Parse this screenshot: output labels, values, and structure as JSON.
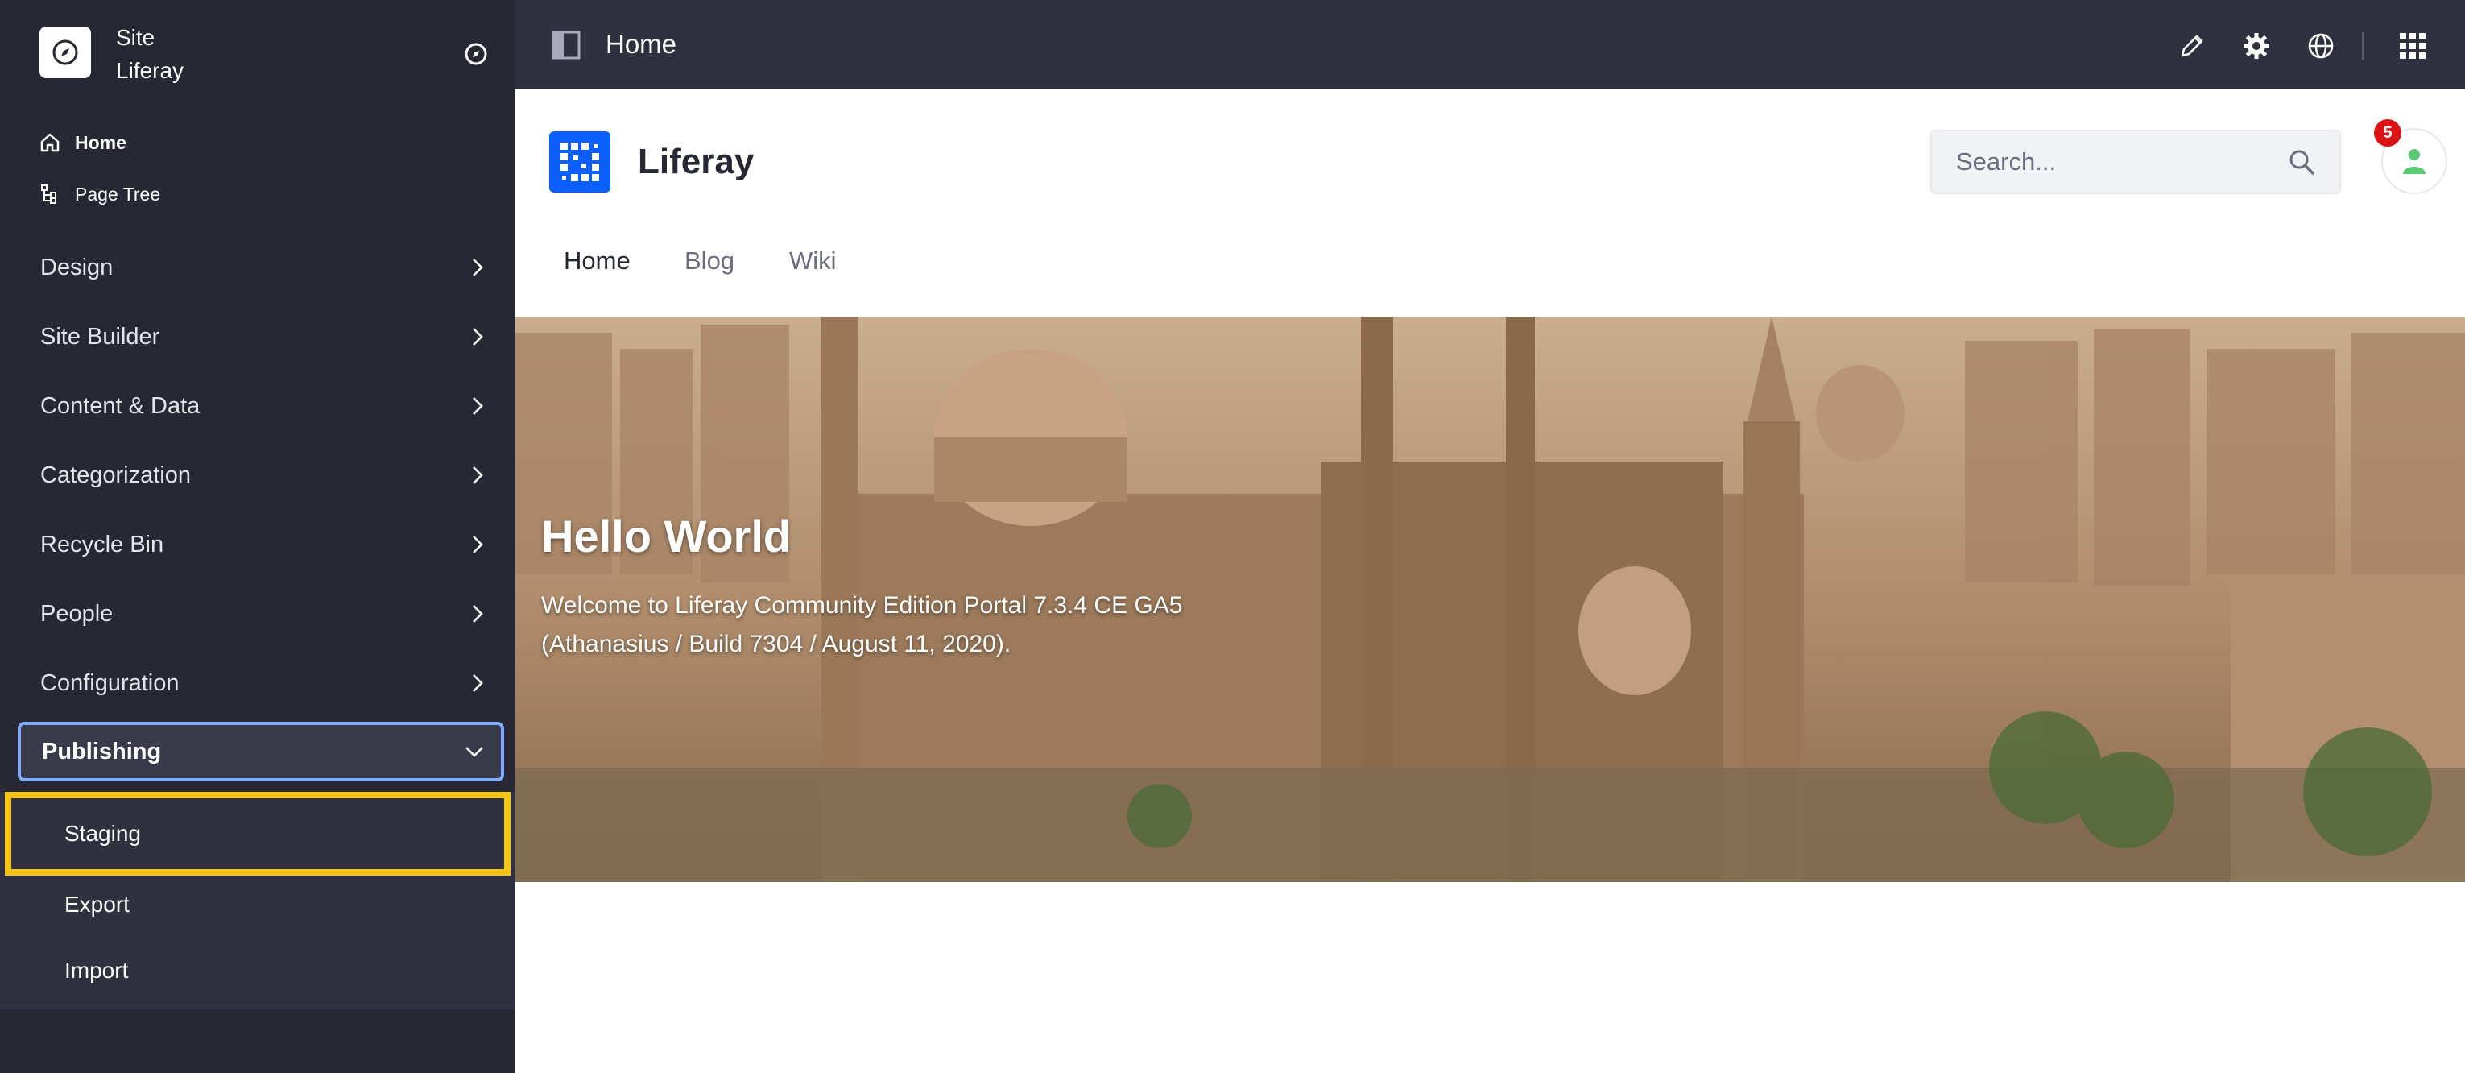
{
  "colors": {
    "sidebar_bg": "#272833",
    "topbar_bg": "#30313f",
    "active_border": "#80acff",
    "highlight": "#f5c518",
    "brand": "#0b5fff",
    "badge": "#da1414"
  },
  "sidebar": {
    "site_label": "Site",
    "site_name": "Liferay",
    "quick_links": [
      {
        "label": "Home",
        "icon": "home-icon"
      },
      {
        "label": "Page Tree",
        "icon": "page-tree-icon"
      }
    ],
    "menu": [
      {
        "label": "Design"
      },
      {
        "label": "Site Builder"
      },
      {
        "label": "Content & Data"
      },
      {
        "label": "Categorization"
      },
      {
        "label": "Recycle Bin"
      },
      {
        "label": "People"
      },
      {
        "label": "Configuration"
      },
      {
        "label": "Publishing",
        "expanded": true
      }
    ],
    "publishing_items": [
      {
        "label": "Staging",
        "highlighted": true
      },
      {
        "label": "Export"
      },
      {
        "label": "Import"
      }
    ]
  },
  "topbar": {
    "title": "Home",
    "icons": [
      "pencil-icon",
      "gear-icon",
      "simulation-icon",
      "apps-grid-icon"
    ]
  },
  "header": {
    "brand": "Liferay",
    "search_placeholder": "Search...",
    "notification_count": "5"
  },
  "site_nav": [
    {
      "label": "Home",
      "selected": true
    },
    {
      "label": "Blog"
    },
    {
      "label": "Wiki"
    }
  ],
  "hero": {
    "title": "Hello World",
    "text_line1": "Welcome to Liferay Community Edition Portal 7.3.4 CE GA5",
    "text_line2": "(Athanasius / Build 7304 / August 11, 2020)."
  }
}
